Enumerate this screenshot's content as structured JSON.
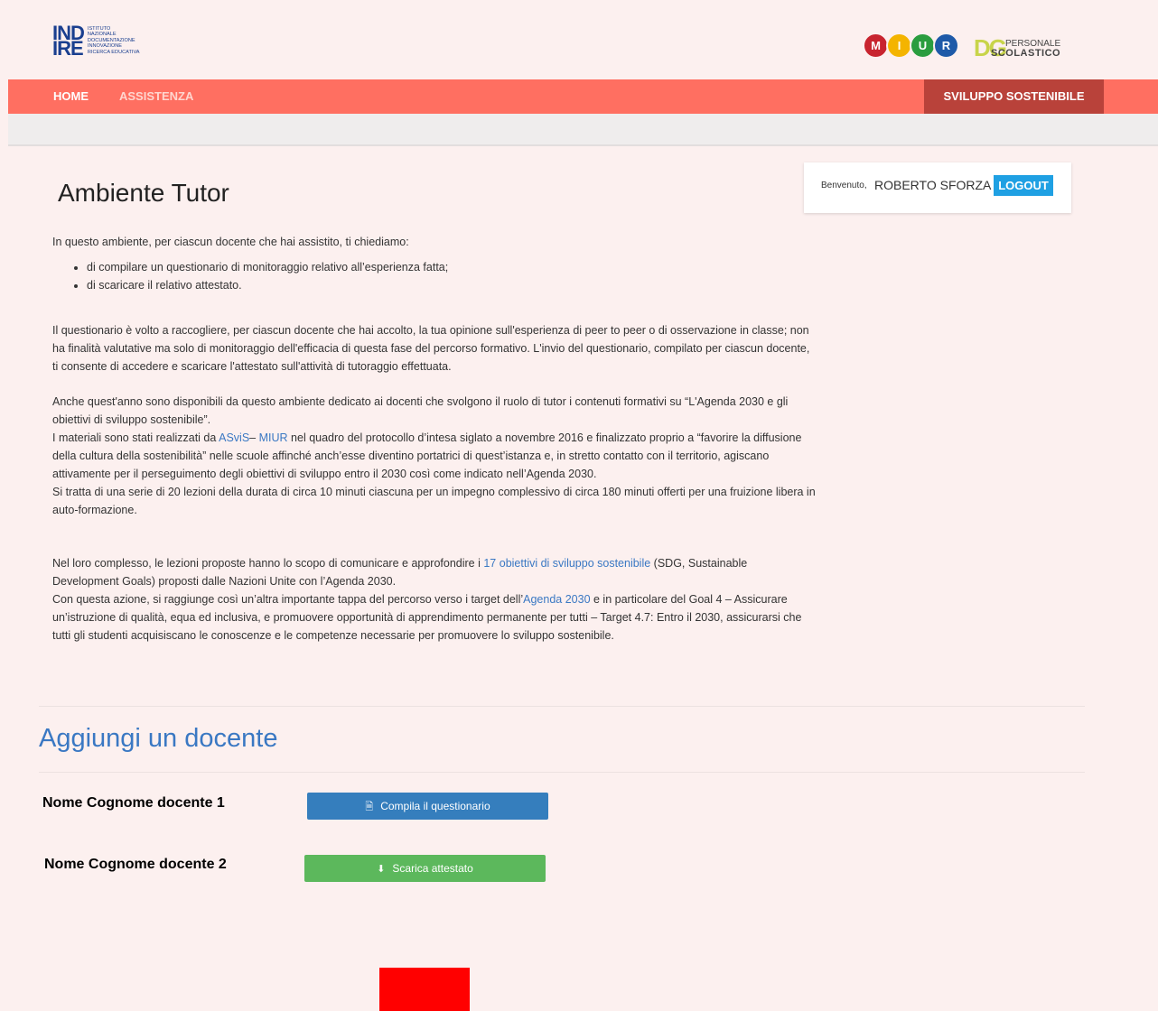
{
  "header": {
    "indire_logo": {
      "big": "IND\nIRE",
      "lines": [
        "ISTITUTO",
        "NAZIONALE",
        "DOCUMENTAZIONE",
        "INNOVAZIONE",
        "RICERCA EDUCATIVA"
      ]
    },
    "miur_logo": {
      "letters": [
        "M",
        "I",
        "U",
        "R"
      ],
      "colors": [
        "#c8242f",
        "#f4b400",
        "#2a9d3f",
        "#1e5aa8"
      ]
    },
    "dg_logo": {
      "mark": "DG",
      "line1": "PERSONALE",
      "line2": "SCOLASTICO"
    }
  },
  "nav": {
    "home": "HOME",
    "assistenza": "ASSISTENZA",
    "right": "SVILUPPO SOSTENIBILE"
  },
  "user": {
    "welcome_label": "Benvenuto,",
    "name": "ROBERTO SFORZA",
    "logout": "LOGOUT"
  },
  "main": {
    "title": "Ambiente Tutor",
    "intro": "In questo ambiente, per ciascun docente che hai assistito, ti chiediamo:",
    "bullets": [
      "di compilare un questionario di monitoraggio relativo all’esperienza fatta;",
      "di scaricare il relativo attestato."
    ],
    "para1": "Il questionario è volto a raccogliere, per ciascun docente che hai accolto, la tua opinione sull'esperienza di peer to peer o di osservazione in classe; non ha finalità valutative ma solo di monitoraggio dell'efficacia di questa fase del percorso formativo. L'invio del questionario, compilato per ciascun docente, ti consente di accedere e scaricare l'attestato sull'attività di tutoraggio effettuata.",
    "para2_a": "Anche quest'anno sono disponibili da questo ambiente dedicato ai docenti che svolgono il ruolo di tutor i contenuti formativi su “L'Agenda 2030 e gli obiettivi di sviluppo sostenibile”.",
    "para2_b_pre": "I materiali sono stati realizzati da ",
    "link_asvis": "ASviS",
    "para2_b_sep": "– ",
    "link_miur": "MIUR",
    "para2_b_post": " nel quadro del protocollo d’intesa siglato a novembre 2016 e finalizzato proprio a “favorire la diffusione della cultura della sostenibilità” nelle scuole affinché anch’esse diventino portatrici di quest’istanza e, in stretto contatto con il territorio, agiscano attivamente per il perseguimento degli obiettivi di sviluppo entro il 2030 così come indicato nell’Agenda 2030.",
    "para2_c": "Si tratta di una serie di 20 lezioni della durata di circa 10 minuti ciascuna per un impegno complessivo di circa 180 minuti offerti per una fruizione libera in auto-formazione.",
    "para3_pre": "Nel loro complesso, le lezioni proposte hanno lo scopo di comunicare e approfondire i ",
    "link_17": "17 obiettivi di sviluppo sostenibile",
    "para3_post": " (SDG, Sustainable Development Goals) proposti dalle Nazioni Unite con l’Agenda 2030.",
    "para4_pre": "Con questa azione, si raggiunge così un’altra importante tappa del percorso verso i target dell’",
    "link_agenda": "Agenda 2030",
    "para4_post": " e in particolare del Goal 4 – Assicurare un’istruzione di qualità, equa ed inclusiva, e promuovere opportunità di apprendimento permanente per tutti – Target 4.7: Entro il 2030, assicurarsi che tutti gli studenti acquisiscano le conoscenze e le competenze necessarie per promuovere lo sviluppo sostenibile."
  },
  "section": {
    "heading": "Aggiungi un docente",
    "teachers": [
      {
        "name": "Nome Cognome docente 1",
        "button": "Compila il questionario",
        "icon": "file-icon"
      },
      {
        "name": "Nome Cognome docente 2",
        "button": "Scarica attestato",
        "icon": "download-icon"
      }
    ]
  },
  "colors": {
    "navbar": "#ff6f61",
    "nav_right": "#b9423a",
    "logout": "#1fa0e3",
    "link": "#3a78c3",
    "btn_blue": "#357ebd",
    "btn_green": "#5cb85c",
    "red_box": "#ff0000"
  }
}
